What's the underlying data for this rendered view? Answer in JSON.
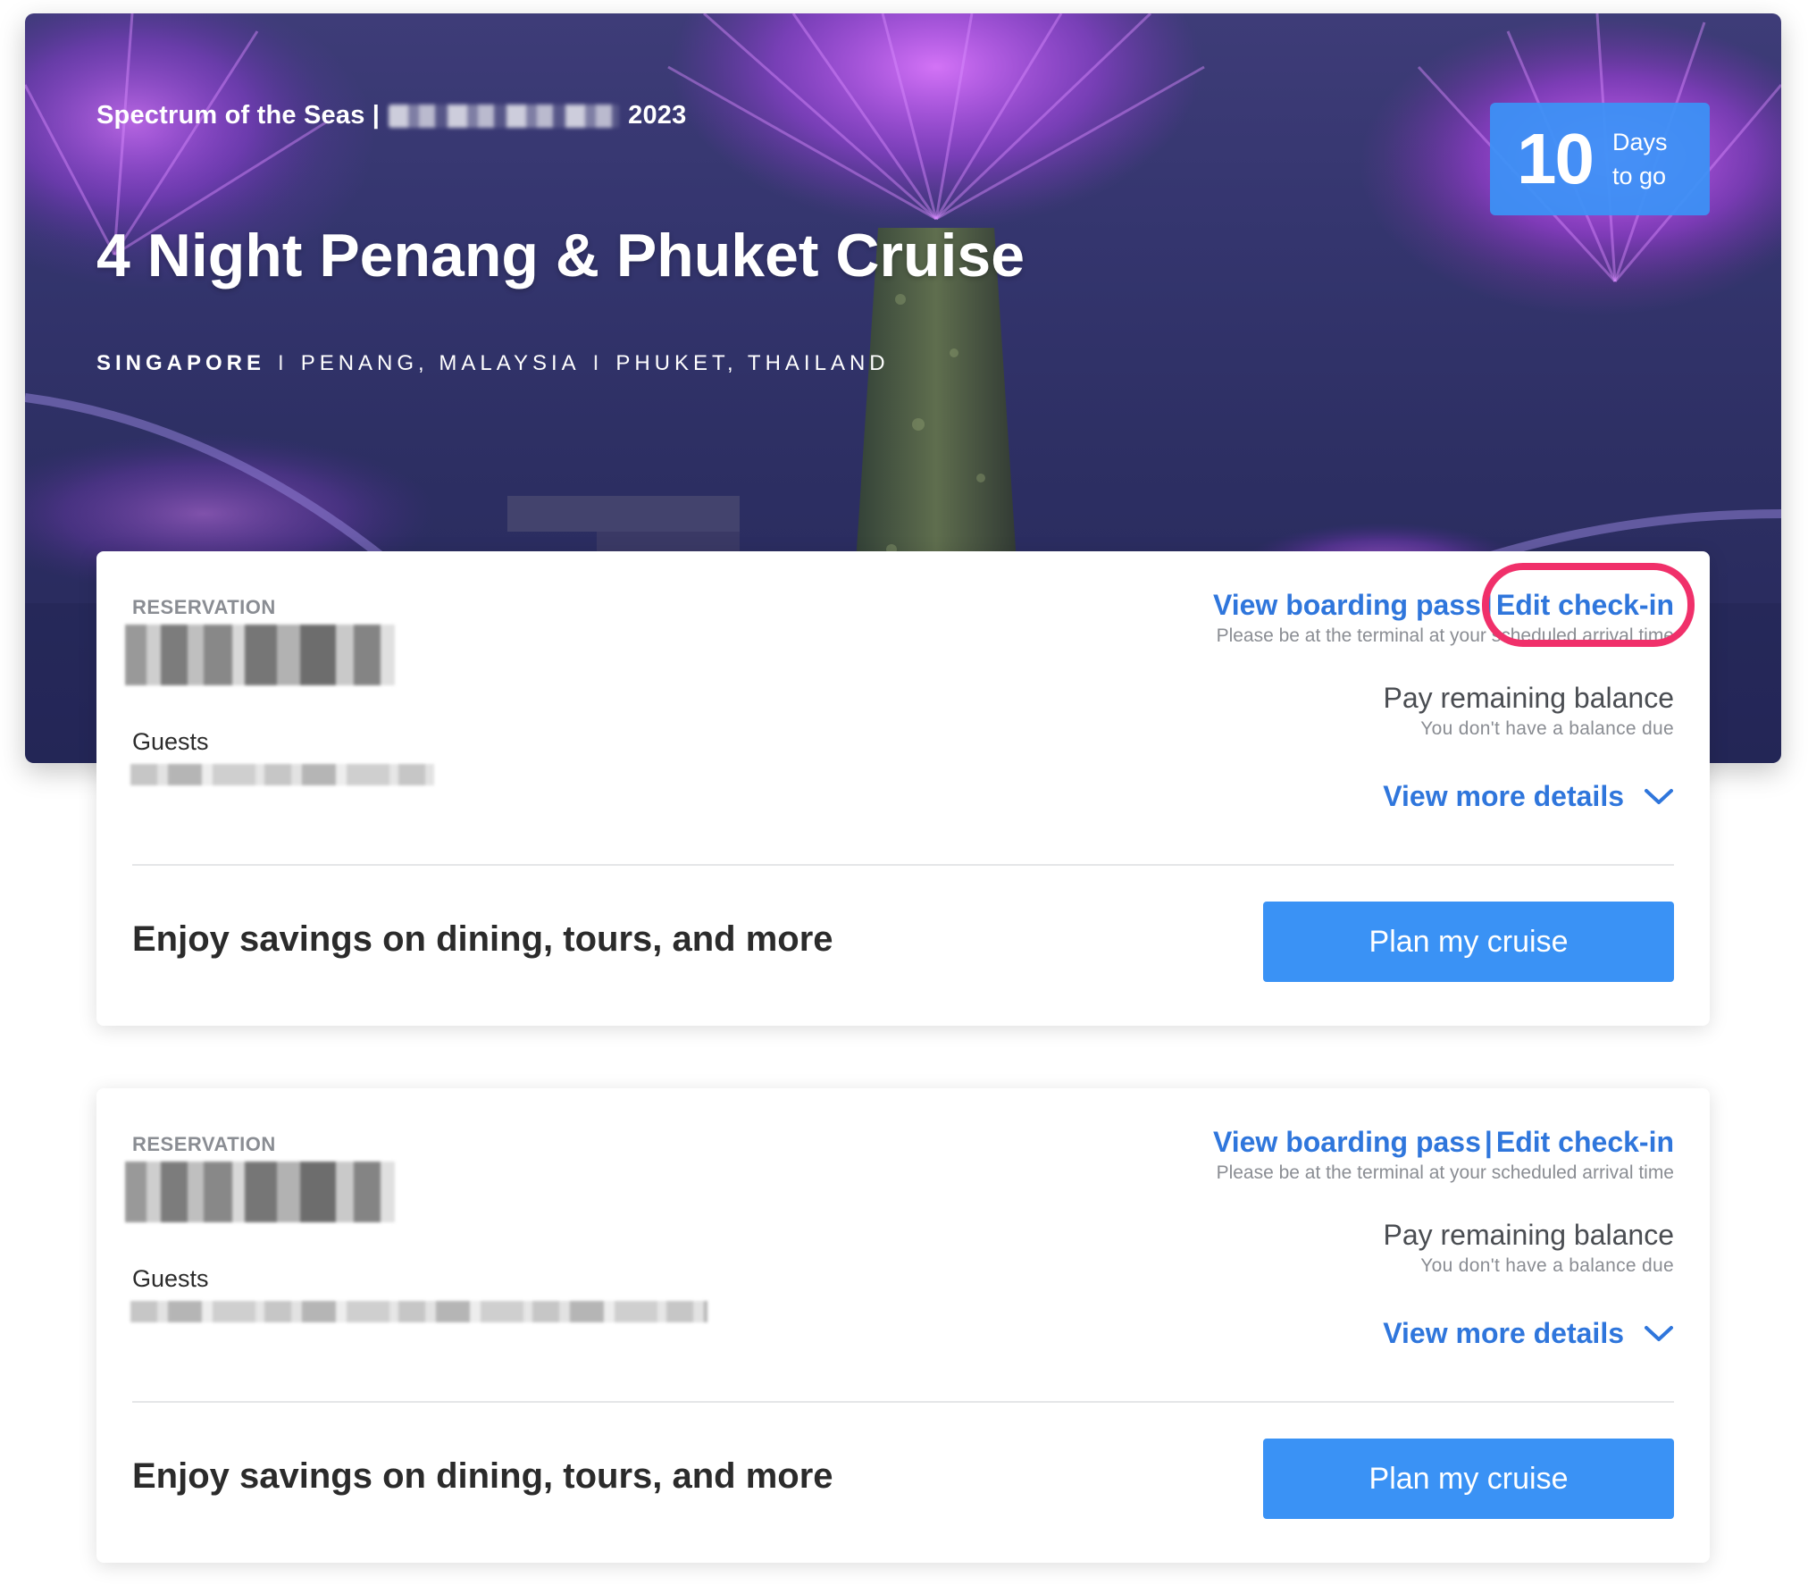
{
  "hero": {
    "ship_prefix": "Spectrum of the Seas |",
    "date_suffix": "2023",
    "title": "4 Night Penang & Phuket Cruise",
    "ports": [
      "SINGAPORE",
      "PENANG, MALAYSIA",
      "PHUKET, THAILAND"
    ],
    "port_separator": "I",
    "countdown": {
      "number": "10",
      "line1": "Days",
      "line2": "to go"
    }
  },
  "reservations": [
    {
      "label": "RESERVATION",
      "guests_label": "Guests",
      "boarding_pass_link": "View boarding pass",
      "link_separator": "|",
      "edit_checkin_link": "Edit check-in",
      "terminal_note": "Please be at the terminal at your scheduled arrival time",
      "pay_title": "Pay remaining balance",
      "pay_sub": "You don't have a balance due",
      "details_link": "View more details",
      "promo_text": "Enjoy savings on dining, tours, and more",
      "plan_button": "Plan my cruise"
    },
    {
      "label": "RESERVATION",
      "guests_label": "Guests",
      "boarding_pass_link": "View boarding pass",
      "link_separator": "|",
      "edit_checkin_link": "Edit check-in",
      "terminal_note": "Please be at the terminal at your scheduled arrival time",
      "pay_title": "Pay remaining balance",
      "pay_sub": "You don't have a balance due",
      "details_link": "View more details",
      "promo_text": "Enjoy savings on dining, tours, and more",
      "plan_button": "Plan my cruise"
    }
  ],
  "colors": {
    "accent_link": "#2f76dc",
    "button": "#3a92f5",
    "highlight": "#f0306a",
    "countdown_bg": "#3b92f6"
  },
  "icons": {
    "details_toggle": "chevron-down-icon"
  }
}
